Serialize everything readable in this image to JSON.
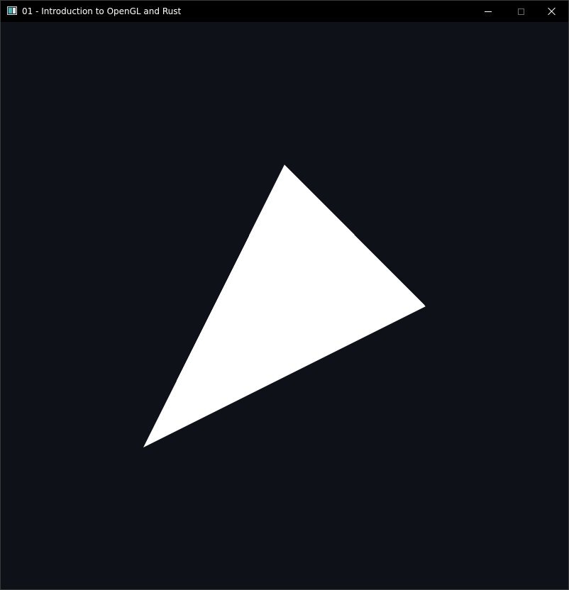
{
  "window": {
    "title": "01 - Introduction to OpenGL and Rust",
    "icon": "app-window-icon",
    "controls": {
      "minimize_icon": "minimize-icon",
      "maximize_icon": "maximize-icon",
      "close_icon": "close-icon"
    }
  },
  "scene": {
    "clear_color": "#0e1118",
    "shape": "triangle",
    "fill_color": "#ffffff"
  }
}
